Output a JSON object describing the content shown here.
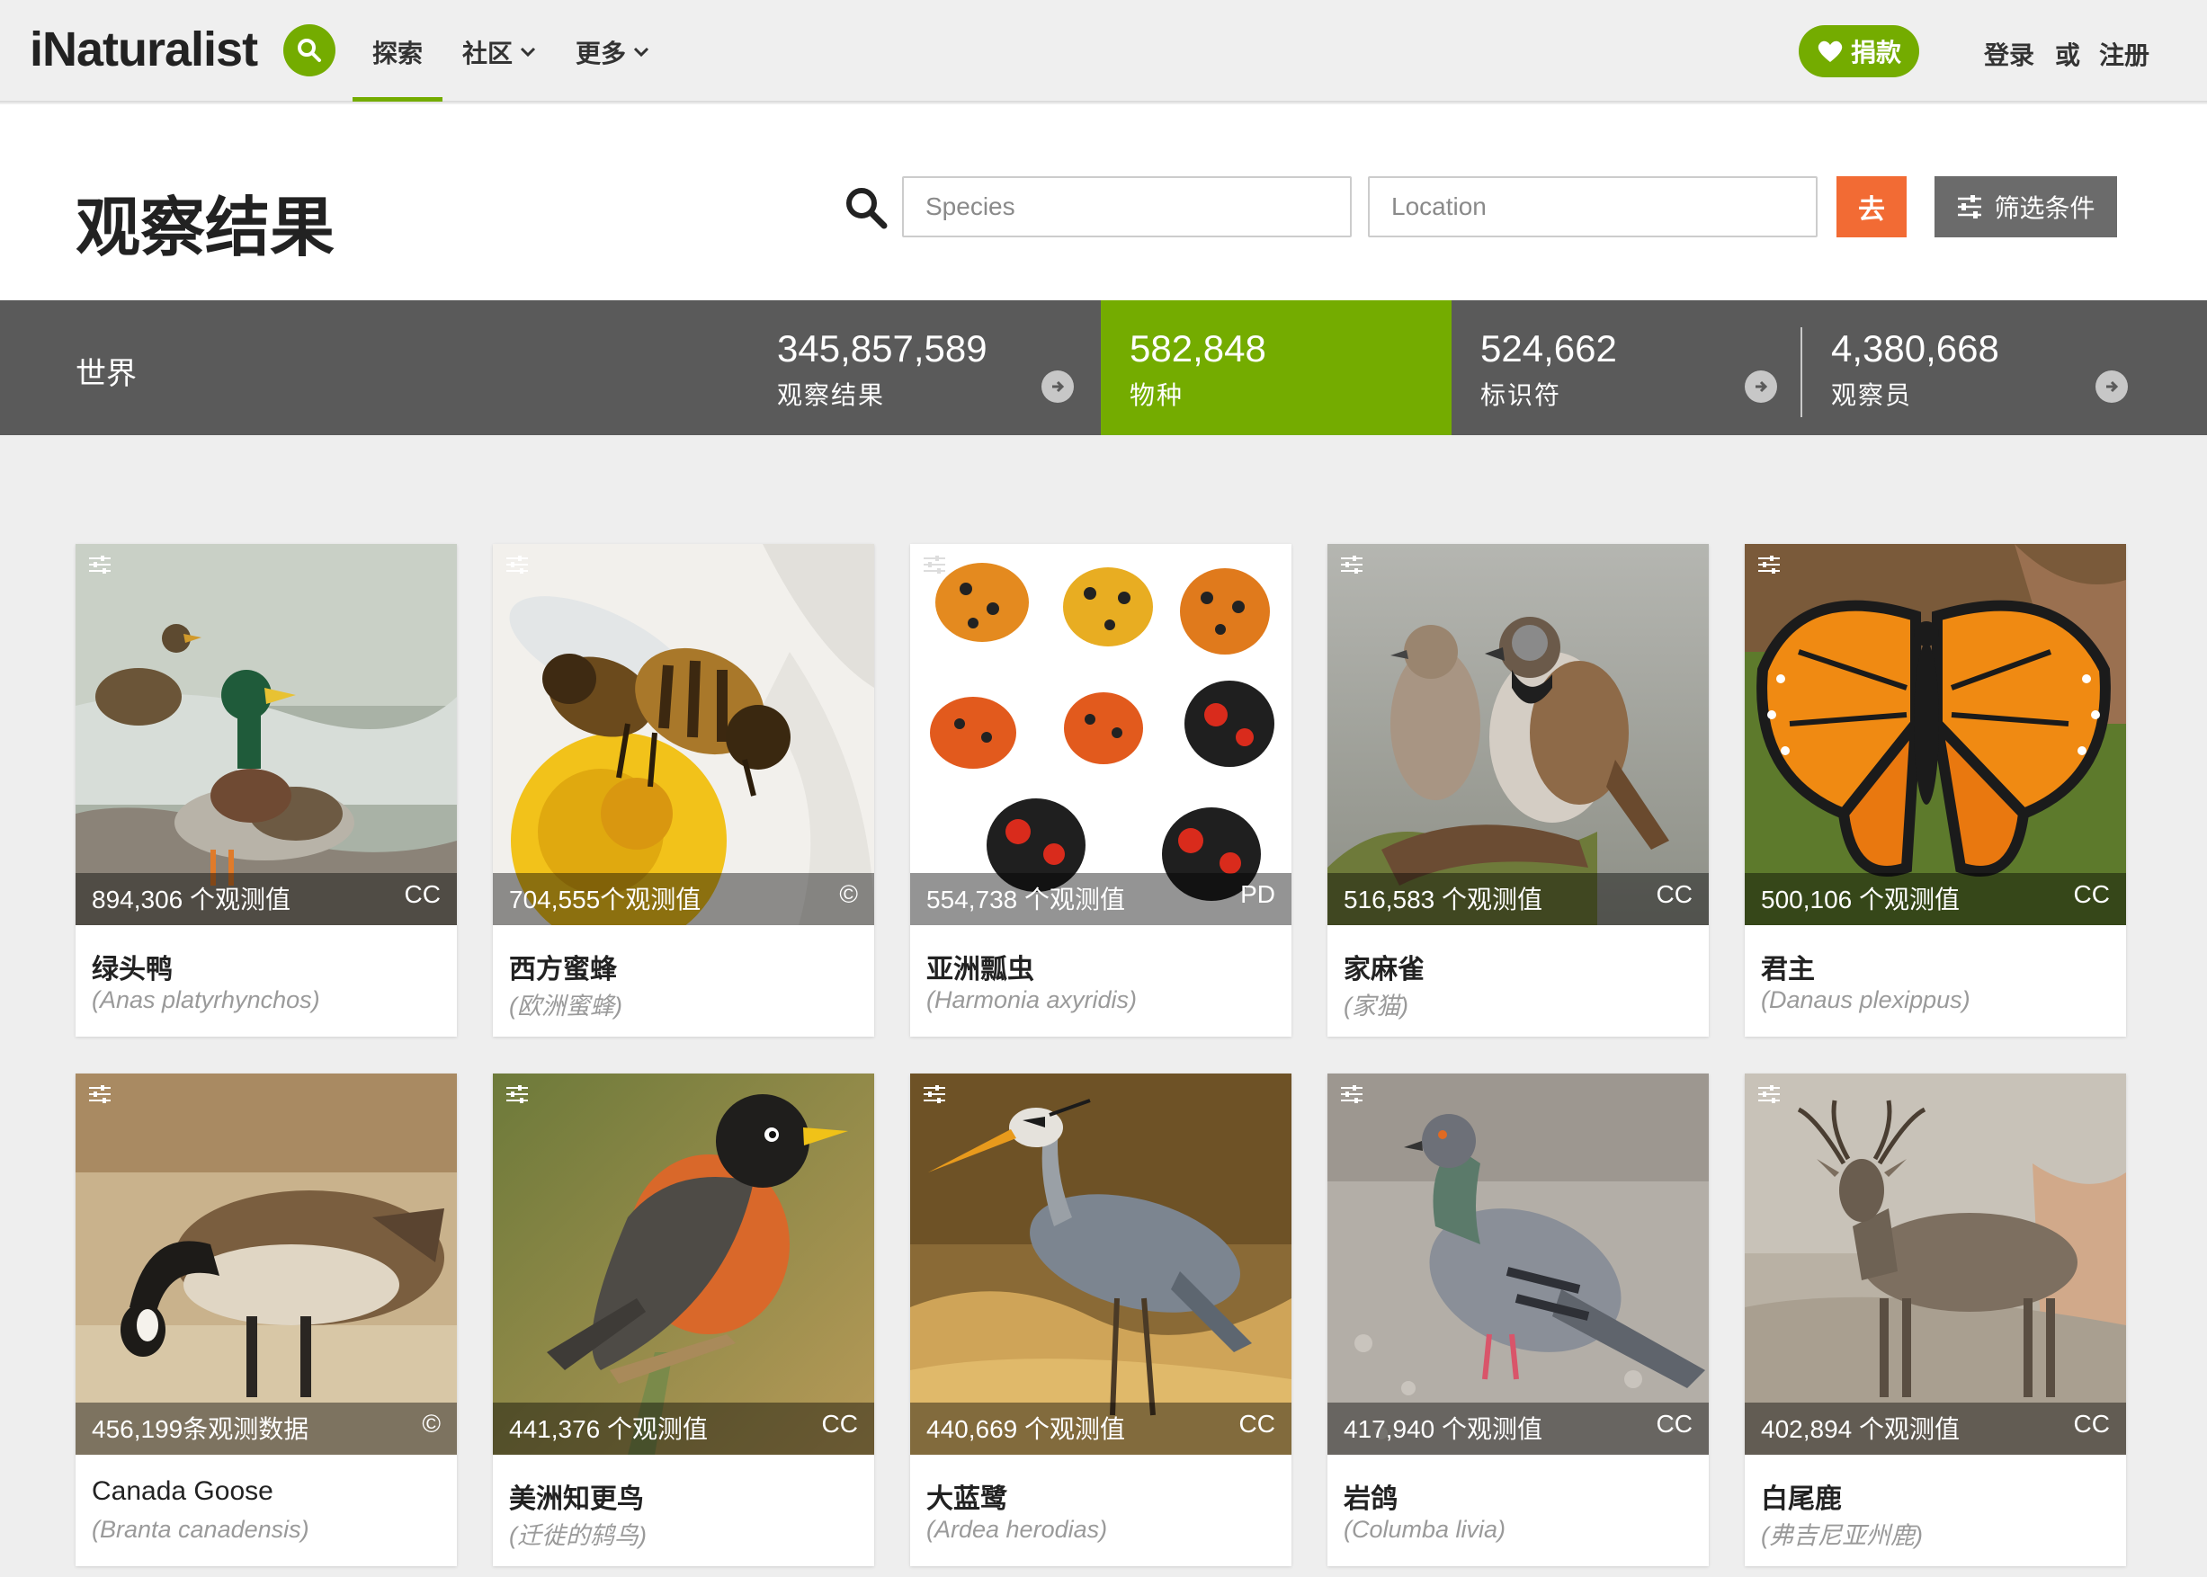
{
  "nav": {
    "logo": "iNaturalist",
    "items": [
      {
        "label": "探索"
      },
      {
        "label": "社区"
      },
      {
        "label": "更多"
      }
    ],
    "donate_label": "捐款",
    "login_label": "登录",
    "or_label": "或",
    "signup_label": "注册"
  },
  "header": {
    "title": "观察结果",
    "species_placeholder": "Species",
    "location_placeholder": "Location",
    "go_label": "去",
    "filters_label": "筛选条件"
  },
  "stats": {
    "place": "世界",
    "items": [
      {
        "value": "345,857,589",
        "label": "观察结果"
      },
      {
        "value": "582,848",
        "label": "物种"
      },
      {
        "value": "524,662",
        "label": "标识符"
      },
      {
        "value": "4,380,668",
        "label": "观察员"
      }
    ]
  },
  "species": [
    {
      "count": "894,306 个观测值",
      "license": "CC",
      "name": "绿头鸭",
      "sci": "(Anas platyrhynchos)"
    },
    {
      "count": "704,555个观测值",
      "license": "©",
      "name": "西方蜜蜂",
      "sci": "(欧洲蜜蜂)"
    },
    {
      "count": "554,738 个观测值",
      "license": "PD",
      "name": "亚洲瓢虫",
      "sci": "(Harmonia axyridis)"
    },
    {
      "count": "516,583 个观测值",
      "license": "CC",
      "name": "家麻雀",
      "sci": "(家猫)"
    },
    {
      "count": "500,106 个观测值",
      "license": "CC",
      "name": "君主",
      "sci": "(Danaus plexippus)"
    },
    {
      "count": "456,199条观测数据",
      "license": "©",
      "name": "Canada Goose",
      "sci": "(Branta canadensis)"
    },
    {
      "count": "441,376 个观测值",
      "license": "CC",
      "name": "美洲知更鸟",
      "sci": "(迁徙的鸫鸟)"
    },
    {
      "count": "440,669 个观测值",
      "license": "CC",
      "name": "大蓝鹭",
      "sci": "(Ardea herodias)"
    },
    {
      "count": "417,940 个观测值",
      "license": "CC",
      "name": "岩鸽",
      "sci": "(Columba livia)"
    },
    {
      "count": "402,894 个观测值",
      "license": "CC",
      "name": "白尾鹿",
      "sci": "(弗吉尼亚州鹿)"
    }
  ],
  "colors": {
    "brand_green": "#74ac00",
    "go_orange": "#f26b34",
    "stats_gray": "#5a5a5a"
  }
}
